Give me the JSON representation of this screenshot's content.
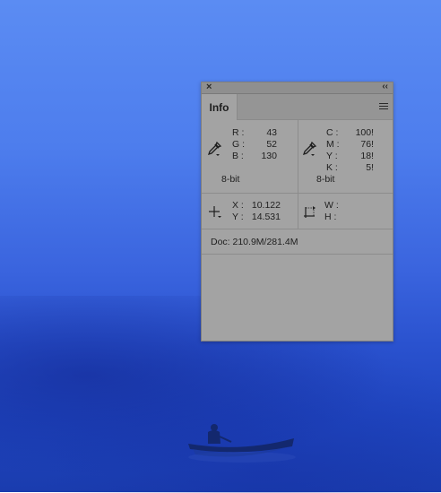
{
  "panel": {
    "tab_label": "Info",
    "close_glyph": "×",
    "collapse_glyph": "‹‹"
  },
  "rgb": {
    "r_label": "R :",
    "r_value": "43",
    "g_label": "G :",
    "g_value": "52",
    "b_label": "B :",
    "b_value": "130",
    "bit_depth": "8-bit"
  },
  "cmyk": {
    "c_label": "C :",
    "c_value": "100!",
    "m_label": "M :",
    "m_value": "76!",
    "y_label": "Y :",
    "y_value": "18!",
    "k_label": "K :",
    "k_value": "5!",
    "bit_depth": "8-bit"
  },
  "position": {
    "x_label": "X :",
    "x_value": "10.122",
    "y_label": "Y :",
    "y_value": "14.531"
  },
  "size": {
    "w_label": "W :",
    "w_value": "",
    "h_label": "H :",
    "h_value": ""
  },
  "doc": {
    "text": "Doc: 210.9M/281.4M"
  },
  "icons": {
    "eyedropper_rgb": "eyedropper-icon",
    "eyedropper_cmyk": "eyedropper-icon",
    "crosshair": "crosshair-icon",
    "selection_size": "selection-size-icon",
    "panel_menu": "hamburger-menu-icon"
  }
}
